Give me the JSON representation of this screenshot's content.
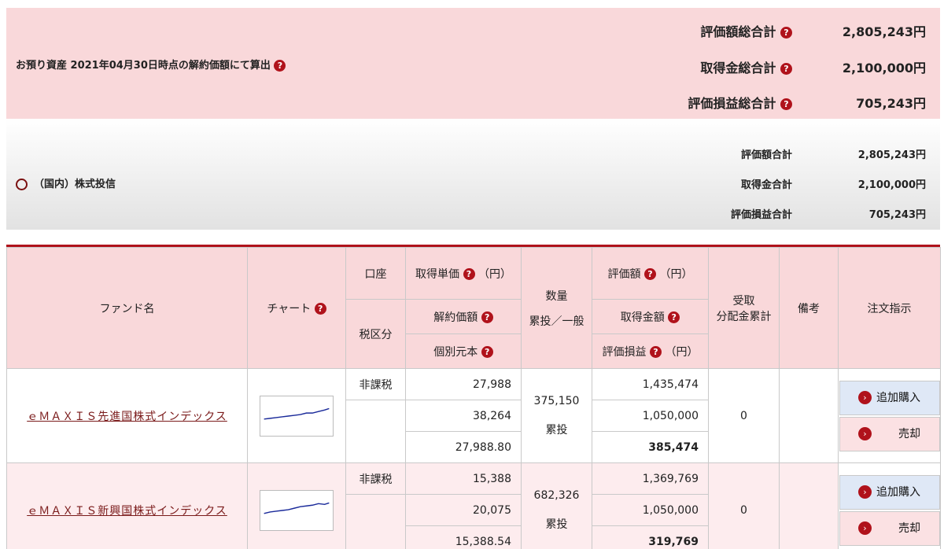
{
  "summary": {
    "title": "お預り資産 2021年04月30日時点の解約価額にて算出",
    "rows": [
      {
        "label": "評価額総合計",
        "value": "2,805,243円"
      },
      {
        "label": "取得金総合計",
        "value": "2,100,000円"
      },
      {
        "label": "評価損益総合計",
        "value": "705,243円"
      }
    ]
  },
  "category": {
    "title": "（国内）株式投信",
    "rows": [
      {
        "label": "評価額合計",
        "value": "2,805,243円"
      },
      {
        "label": "取得金合計",
        "value": "2,100,000円"
      },
      {
        "label": "評価損益合計",
        "value": "705,243円"
      }
    ]
  },
  "header": {
    "fund_name": "ファンド名",
    "chart": "チャート",
    "account": "口座",
    "tax": "税区分",
    "acq_unit_price": "取得単価",
    "unit_yen": "（円）",
    "cancel_price": "解約価額",
    "individual_principal": "個別元本",
    "quantity": "数量",
    "quantity_sub": "累投／一般",
    "valuation": "評価額",
    "acq_amount": "取得金額",
    "valuation_pl": "評価損益",
    "dividend_line1": "受取",
    "dividend_line2": "分配金累計",
    "notes": "備考",
    "order": "注文指示"
  },
  "funds": [
    {
      "name": "ｅＭＡＸＩＳ先進国株式インデックス",
      "tax": "非課税",
      "acq_unit_price": "27,988",
      "cancel_price": "38,264",
      "individual_principal": "27,988.80",
      "quantity": "375,150",
      "quantity_type": "累投",
      "valuation": "1,435,474",
      "acq_amount": "1,050,000",
      "valuation_pl": "385,474",
      "dividend": "0",
      "buy_label": "追加購入",
      "sell_label": "売却"
    },
    {
      "name": "ｅＭＡＸＩＳ新興国株式インデックス",
      "tax": "非課税",
      "acq_unit_price": "15,388",
      "cancel_price": "20,075",
      "individual_principal": "15,388.54",
      "quantity": "682,326",
      "quantity_type": "累投",
      "valuation": "1,369,769",
      "acq_amount": "1,050,000",
      "valuation_pl": "319,769",
      "dividend": "0",
      "buy_label": "追加購入",
      "sell_label": "売却"
    }
  ],
  "icons": {
    "help": "question-circle-icon",
    "arrow": "chevron-right-circle-icon",
    "accent": "#b0121b"
  }
}
